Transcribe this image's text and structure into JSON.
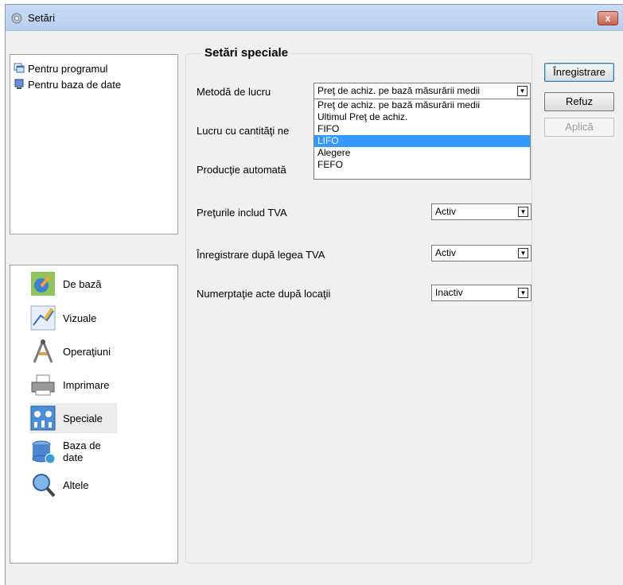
{
  "window": {
    "title": "Setări",
    "close_label": "x"
  },
  "tree": {
    "items": [
      {
        "label": "Pentru programul",
        "icon": "windows-icon"
      },
      {
        "label": "Pentru baza de date",
        "icon": "computer-icon"
      }
    ]
  },
  "categories": {
    "items": [
      {
        "label": "De bază",
        "icon": "globe-wrench-icon",
        "selected": false
      },
      {
        "label": "Vizuale",
        "icon": "brush-icon",
        "selected": false
      },
      {
        "label": "Operaţiuni",
        "icon": "compass-icon",
        "selected": false
      },
      {
        "label": "Imprimare",
        "icon": "printer-icon",
        "selected": false
      },
      {
        "label": "Speciale",
        "icon": "special-settings-icon",
        "selected": true
      },
      {
        "label": "Baza de date",
        "icon": "database-icon",
        "selected": false
      },
      {
        "label": "Altele",
        "icon": "magnifier-icon",
        "selected": false
      }
    ]
  },
  "settings": {
    "section_title": "Setări speciale",
    "rows": [
      {
        "label": "Metodă de lucru",
        "value": "Preţ de achiz. pe bază măsurării medii"
      },
      {
        "label": "Lucru cu cantităţi ne"
      },
      {
        "label": "Producţie automată"
      },
      {
        "label": "Preţurile includ TVA",
        "value": "Activ"
      },
      {
        "label": "Înregistrare după legea TVA",
        "value": "Activ"
      },
      {
        "label": "Numerptaţie acte după locaţii",
        "value": "Inactiv"
      }
    ],
    "dropdown_options": [
      "Preţ de achiz. pe bază măsurării medii",
      "Ultimul Preţ de achiz.",
      "FIFO",
      "LIFO",
      "Alegere",
      "FEFO"
    ],
    "highlighted_option": "LIFO"
  },
  "buttons": {
    "save": "Înregistrare",
    "cancel": "Refuz",
    "apply": "Aplică"
  },
  "colors": {
    "selection": "#3399ff",
    "titlebar": "#c9dcf3"
  }
}
